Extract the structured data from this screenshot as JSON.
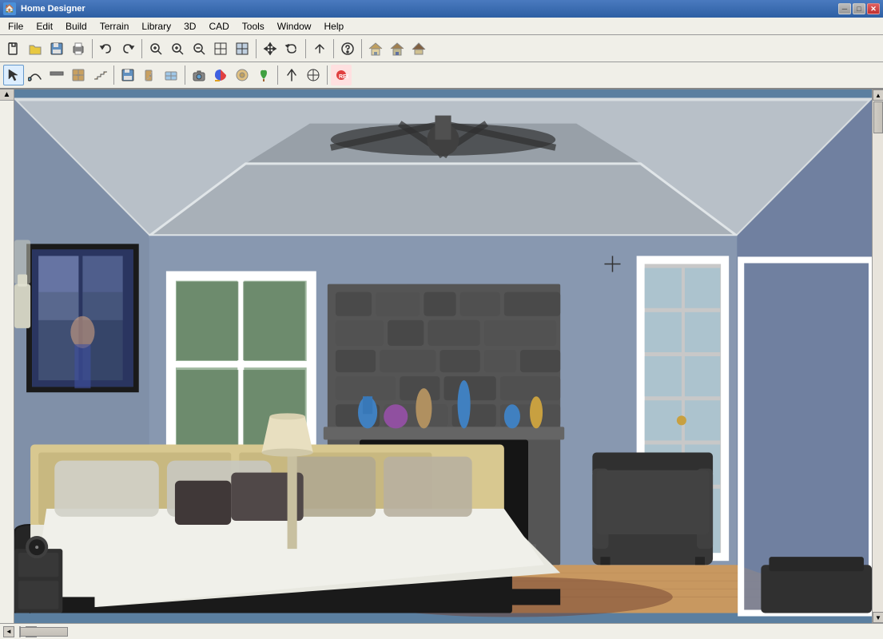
{
  "window": {
    "title": "Home Designer",
    "icon": "🏠"
  },
  "title_controls": {
    "minimize": "─",
    "maximize": "□",
    "close": "✕"
  },
  "menu": {
    "items": [
      "File",
      "Edit",
      "Build",
      "Terrain",
      "Library",
      "3D",
      "CAD",
      "Tools",
      "Window",
      "Help"
    ]
  },
  "toolbar1": {
    "buttons": [
      {
        "name": "new",
        "icon": "📄"
      },
      {
        "name": "open",
        "icon": "📁"
      },
      {
        "name": "save",
        "icon": "💾"
      },
      {
        "name": "print",
        "icon": "🖨"
      },
      {
        "name": "undo",
        "icon": "↩"
      },
      {
        "name": "redo",
        "icon": "↪"
      },
      {
        "name": "zoom-fit",
        "icon": "🔍"
      },
      {
        "name": "zoom-in",
        "icon": "🔍"
      },
      {
        "name": "zoom-out",
        "icon": "🔍"
      },
      {
        "name": "zoom-box",
        "icon": "⊞"
      },
      {
        "name": "zoom-selected",
        "icon": "⊟"
      },
      {
        "name": "pan",
        "icon": "✋"
      },
      {
        "name": "orbit",
        "icon": "⟳"
      },
      {
        "name": "help",
        "icon": "?"
      },
      {
        "name": "house-ext",
        "icon": "🏠"
      },
      {
        "name": "house-int",
        "icon": "🏠"
      },
      {
        "name": "house-roof",
        "icon": "🏠"
      }
    ]
  },
  "toolbar2": {
    "buttons": [
      {
        "name": "select",
        "icon": "↖"
      },
      {
        "name": "curve",
        "icon": "∿"
      },
      {
        "name": "wall",
        "icon": "▬"
      },
      {
        "name": "cabinet",
        "icon": "▦"
      },
      {
        "name": "stair",
        "icon": "▤"
      },
      {
        "name": "save2",
        "icon": "💾"
      },
      {
        "name": "door",
        "icon": "▭"
      },
      {
        "name": "window2",
        "icon": "⊞"
      },
      {
        "name": "camera",
        "icon": "📷"
      },
      {
        "name": "color",
        "icon": "🎨"
      },
      {
        "name": "material",
        "icon": "◉"
      },
      {
        "name": "plant",
        "icon": "🌿"
      },
      {
        "name": "arrow-up",
        "icon": "↑"
      },
      {
        "name": "transform",
        "icon": "⊕"
      },
      {
        "name": "record",
        "icon": "⏺"
      }
    ]
  },
  "status": {
    "text": ""
  },
  "colors": {
    "titlebar_start": "#4a7abf",
    "titlebar_end": "#2d5fa3",
    "menubar_bg": "#f0efe8",
    "toolbar_bg": "#f0efe8",
    "viewport_bg": "#7090b0"
  }
}
